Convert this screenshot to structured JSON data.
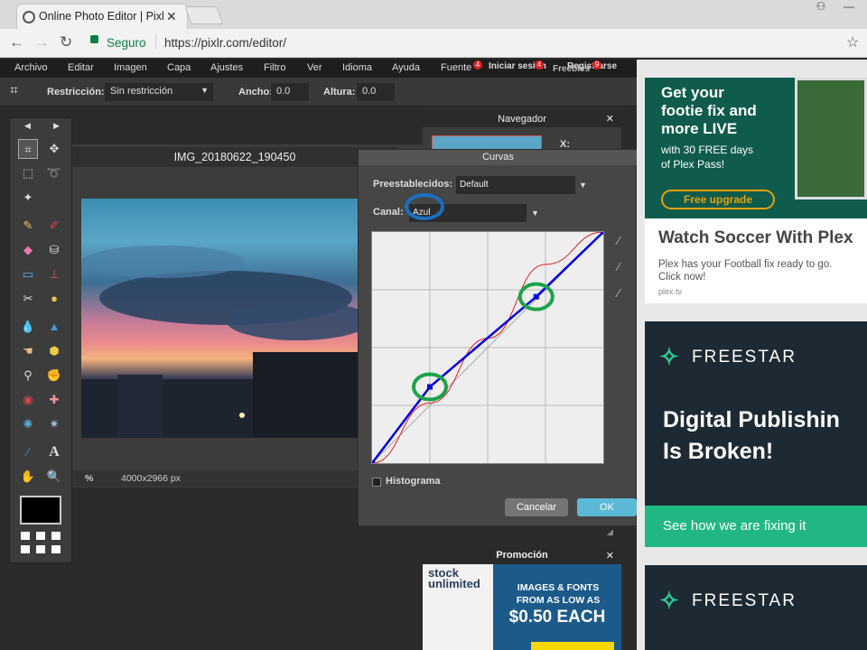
{
  "browser": {
    "tab_title": "Online Photo Editor | Pixlr",
    "tab_close": "✕",
    "secure_label": "Seguro",
    "url": "https://pixlr.com/editor/"
  },
  "menu": {
    "items": [
      "Archivo",
      "Editar",
      "Imagen",
      "Capa",
      "Ajustes",
      "Filtro",
      "Ver",
      "Idioma",
      "Ayuda",
      "Fuente"
    ],
    "overlap_text_1": "Iniciar sesión",
    "overlap_text_2": "Registrarse",
    "overlap_text_3": "Freebies",
    "badges": [
      "4",
      "4",
      "9"
    ]
  },
  "options": {
    "restriction_label": "Restricción:",
    "restriction_value": "Sin restricción",
    "width_label": "Ancho:",
    "width_value": "0.0",
    "height_label": "Altura:",
    "height_value": "0.0"
  },
  "document": {
    "title": "IMG_20180622_190450",
    "zoom_unit": "%",
    "size": "4000x2966 px"
  },
  "navigator": {
    "title": "Navegador",
    "x_label": "X:",
    "close": "✕"
  },
  "curves": {
    "title": "Curvas",
    "presets_label": "Preestablecidos:",
    "presets_value": "Default",
    "channel_label": "Canal:",
    "channel_value": "Azul",
    "histogram_label": "Histograma",
    "cancel": "Cancelar",
    "ok": "OK",
    "blue_curve_points": [
      [
        0,
        0
      ],
      [
        0.25,
        0.33
      ],
      [
        0.71,
        0.72
      ],
      [
        1,
        1
      ]
    ],
    "red_curve_points": [
      [
        0,
        0
      ],
      [
        0.25,
        0.26
      ],
      [
        0.5,
        0.54
      ],
      [
        0.75,
        0.86
      ],
      [
        1,
        1
      ]
    ],
    "colors": {
      "blue": "#0000dd",
      "red": "#e02020",
      "highlight_green": "#1aa34a",
      "highlight_blue": "#1a6fc2"
    }
  },
  "promo": {
    "title": "Promoción",
    "close": "✕",
    "brand": "stock unlimited",
    "headline1": "IMAGES & FONTS",
    "headline2": "FROM AS LOW AS",
    "price": "$0.50 EACH"
  },
  "ads": {
    "ad1": {
      "h1": "Get your",
      "h2": "footie fix and",
      "h3": "more LIVE",
      "sub1": "with 30 FREE days",
      "sub2": "of Plex Pass!",
      "cta": "Free upgrade",
      "title": "Watch Soccer With Plex",
      "body1": "Plex has your Football fix ready to go.",
      "body2": "Click now!",
      "domain": "plex.tv"
    },
    "ad2": {
      "brand": "FREESTAR",
      "head1": "Digital Publishin",
      "head2": "Is Broken!",
      "cta": "See how we are fixing it"
    },
    "ad3": {
      "brand": "FREESTAR"
    }
  }
}
